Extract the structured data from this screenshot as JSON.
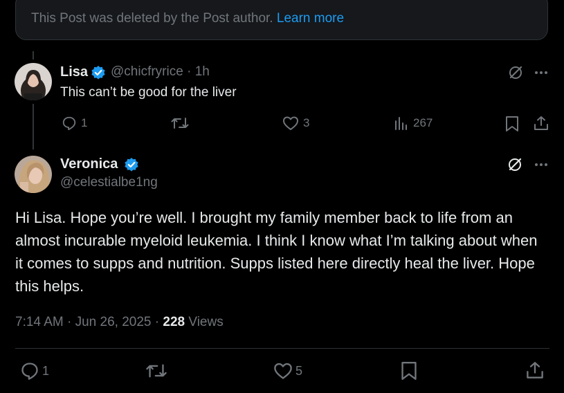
{
  "deleted_notice": {
    "text": "This Post was deleted by the Post author.",
    "link": "Learn more"
  },
  "reply": {
    "name": "Lisa",
    "handle": "@chicfryrice",
    "separator": "·",
    "time": "1h",
    "text": "This can’t be good for the liver",
    "replies": "1",
    "likes": "3",
    "views": "267",
    "icons": [
      "grok-icon",
      "more-icon",
      "reply-icon",
      "retweet-icon",
      "heart-icon",
      "views-icon",
      "bookmark-icon",
      "share-icon"
    ]
  },
  "post": {
    "name": "Veronica",
    "handle": "@celestialbe1ng",
    "text": "Hi Lisa. Hope you’re well. I brought my family member back to life from an almost incurable myeloid leukemia. I think I know what I’m talking about when it comes to supps and nutrition. Supps listed here directly heal the liver. Hope this helps.",
    "time": "7:14 AM",
    "dot": "·",
    "date": "Jun 26, 2025",
    "views_count": "228",
    "views_label": "Views",
    "replies": "1",
    "likes": "5"
  },
  "colors": {
    "background": "#000000",
    "text": "#e7e9ea",
    "muted": "#71767b",
    "accent": "#1d9bf0",
    "border": "#2f3336"
  }
}
